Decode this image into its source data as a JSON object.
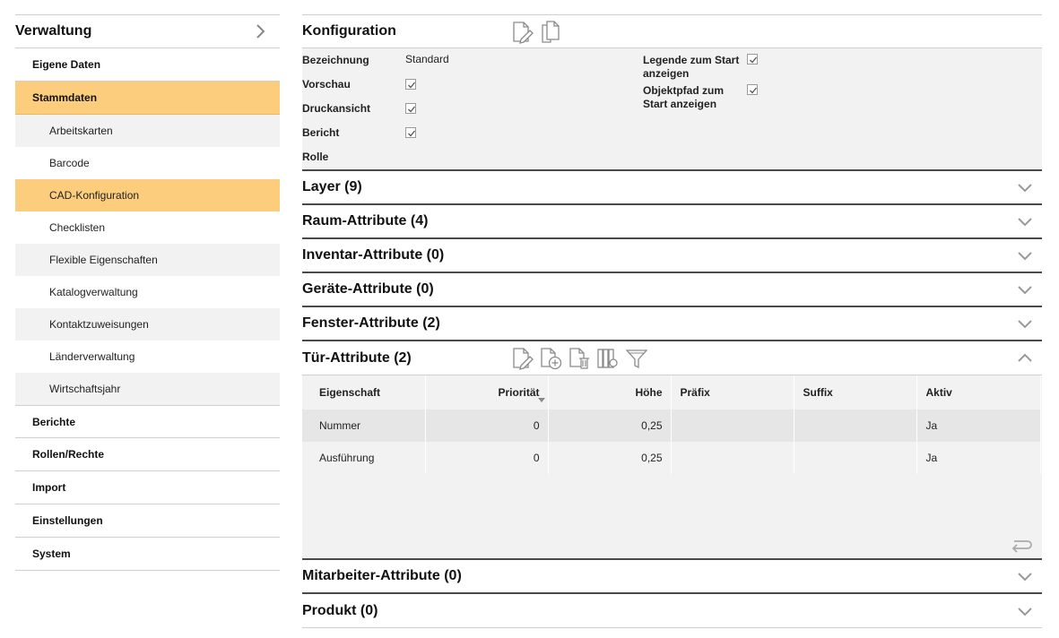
{
  "sidebar": {
    "title": "Verwaltung",
    "sections": [
      {
        "label": "Eigene Daten"
      },
      {
        "label": "Stammdaten"
      }
    ],
    "subitems": [
      {
        "label": "Arbeitskarten"
      },
      {
        "label": "Barcode"
      },
      {
        "label": "CAD-Konfiguration"
      },
      {
        "label": "Checklisten"
      },
      {
        "label": "Flexible Eigenschaften"
      },
      {
        "label": "Katalogverwaltung"
      },
      {
        "label": "Kontaktzuweisungen"
      },
      {
        "label": "Länderverwaltung"
      },
      {
        "label": "Wirtschaftsjahr"
      }
    ],
    "bottom_sections": [
      {
        "label": "Berichte"
      },
      {
        "label": "Rollen/Rechte"
      },
      {
        "label": "Import"
      },
      {
        "label": "Einstellungen"
      },
      {
        "label": "System"
      }
    ]
  },
  "config": {
    "title": "Konfiguration",
    "fields": {
      "bezeichnung_label": "Bezeichnung",
      "bezeichnung_value": "Standard",
      "vorschau_label": "Vorschau",
      "druckansicht_label": "Druckansicht",
      "bericht_label": "Bericht",
      "rolle_label": "Rolle",
      "legende_label_1": "Legende zum Start",
      "legende_label_2": "anzeigen",
      "objektpfad_label_1": "Objektpfad zum",
      "objektpfad_label_2": "Start anzeigen"
    },
    "checked": {
      "vorschau": true,
      "druckansicht": true,
      "bericht": true,
      "legende": true,
      "objektpfad": true
    }
  },
  "panels": {
    "layer": "Layer (9)",
    "raum": "Raum-Attribute (4)",
    "inventar": "Inventar-Attribute (0)",
    "geraete": "Geräte-Attribute (0)",
    "fenster": "Fenster-Attribute (2)",
    "tuer": "Tür-Attribute (2)",
    "mitarbeiter": "Mitarbeiter-Attribute (0)",
    "produkt": "Produkt (0)"
  },
  "tuer_table": {
    "columns": {
      "eigenschaft": "Eigenschaft",
      "prioritaet": "Priorität",
      "hoehe": "Höhe",
      "praefix": "Präfix",
      "suffix": "Suffix",
      "aktiv": "Aktiv"
    },
    "rows": [
      {
        "eigenschaft": "Nummer",
        "prioritaet": "0",
        "hoehe": "0,25",
        "praefix": "",
        "suffix": "",
        "aktiv": "Ja"
      },
      {
        "eigenschaft": "Ausführung",
        "prioritaet": "0",
        "hoehe": "0,25",
        "praefix": "",
        "suffix": "",
        "aktiv": "Ja"
      }
    ]
  },
  "colors": {
    "accent": "#fccd7c",
    "panel_bg": "#f2f2f2",
    "row_highlight": "#e6e6e6",
    "icon_gray": "#8a8a8a"
  },
  "icons": {
    "sidebar_head": "chevron-right-icon",
    "config_tools": [
      "edit-document-icon",
      "copy-document-icon"
    ],
    "tuer_tools": [
      "edit-document-icon",
      "add-document-icon",
      "delete-document-icon",
      "column-settings-icon",
      "filter-icon"
    ],
    "collapsed": "chevron-down-icon",
    "expanded": "chevron-up-icon",
    "back": "return-arrow-icon"
  }
}
